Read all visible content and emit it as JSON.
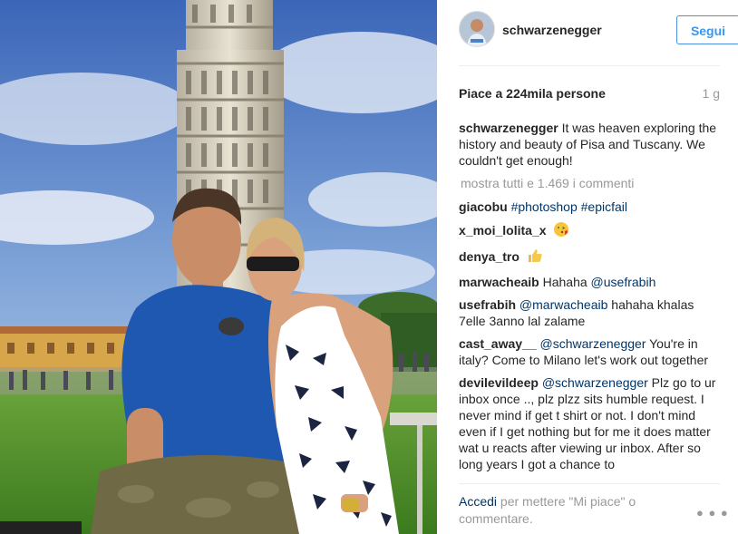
{
  "post": {
    "author": "schwarzenegger",
    "follow_label": "Segui",
    "likes": "Piace a 224mila persone",
    "time": "1 g",
    "caption": {
      "user": "schwarzenegger",
      "text": "It was heaven exploring the history and beauty of Pisa and Tuscany. We couldn't get enough!"
    },
    "show_all": "mostra tutti e 1.469 i commenti",
    "comments": [
      {
        "user": "giacobu",
        "parts": [
          "#photoshop",
          " ",
          "#epicfail"
        ]
      },
      {
        "user": "x_moi_lolita_x",
        "emoji": "face-blowing-kiss-icon"
      },
      {
        "user": "denya_tro",
        "emoji": "thumbs-up-icon"
      },
      {
        "user": "marwacheaib",
        "text": "Hahaha ",
        "mention": "@usefrabih"
      },
      {
        "user": "usefrabih",
        "mention": "@marwacheaib",
        "text": " hahaha khalas 7elle 3anno lal zalame"
      },
      {
        "user": "cast_away__",
        "mention": "@schwarzenegger",
        "text": " You're in italy? Come to Milano let's work out together"
      },
      {
        "user": "devilevildeep",
        "mention": "@schwarzenegger",
        "text": " Plz go to ur inbox once .., plz plzz sits humble request. I never mind if get t shirt or not. I don't mind even if I get nothing but for me it does matter wat u reacts after viewing ur inbox. After so long years I got a chance to"
      }
    ],
    "footer": {
      "login_link": "Accedi",
      "login_text": " per mettere \"Mi piace\" o commentare."
    },
    "more_icon": "more-options-icon"
  }
}
